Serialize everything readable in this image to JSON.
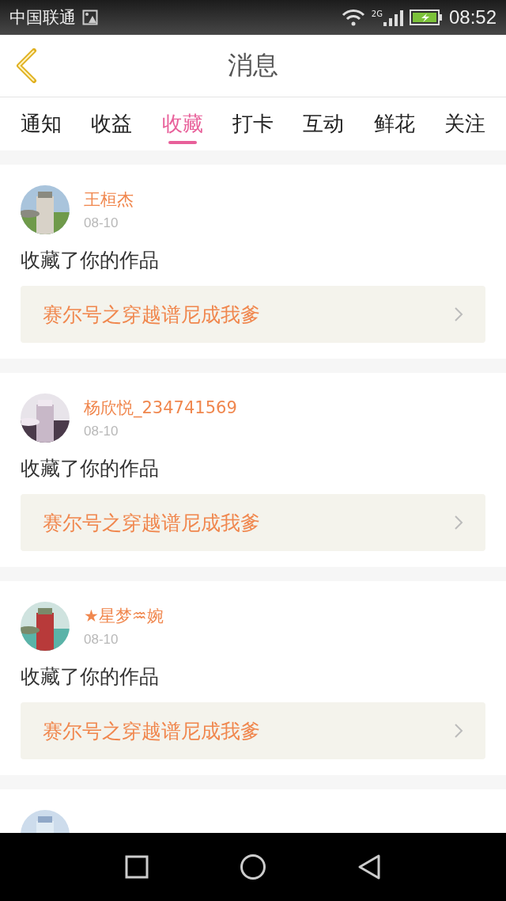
{
  "status_bar": {
    "carrier": "中国联通",
    "network": "2G",
    "time": "08:52"
  },
  "header": {
    "title": "消息"
  },
  "tabs": [
    {
      "label": "通知",
      "selected": false
    },
    {
      "label": "收益",
      "selected": false
    },
    {
      "label": "收藏",
      "selected": true
    },
    {
      "label": "打卡",
      "selected": false
    },
    {
      "label": "互动",
      "selected": false
    },
    {
      "label": "鲜花",
      "selected": false
    },
    {
      "label": "关注",
      "selected": false
    }
  ],
  "messages": [
    {
      "avatar": {
        "kind": "picture"
      },
      "name": "王桓杰",
      "date": "08-10",
      "action": "收藏了你的作品",
      "work": "赛尔号之穿越谱尼成我爹"
    },
    {
      "avatar": {
        "kind": "picture"
      },
      "name": "杨欣悦_234741569",
      "date": "08-10",
      "action": "收藏了你的作品",
      "work": "赛尔号之穿越谱尼成我爹"
    },
    {
      "avatar": {
        "kind": "picture"
      },
      "name": "★星梦♒婉",
      "date": "08-10",
      "action": "收藏了你的作品",
      "work": "赛尔号之穿越谱尼成我爹"
    },
    {
      "avatar": {
        "kind": "picture"
      }
    }
  ]
}
